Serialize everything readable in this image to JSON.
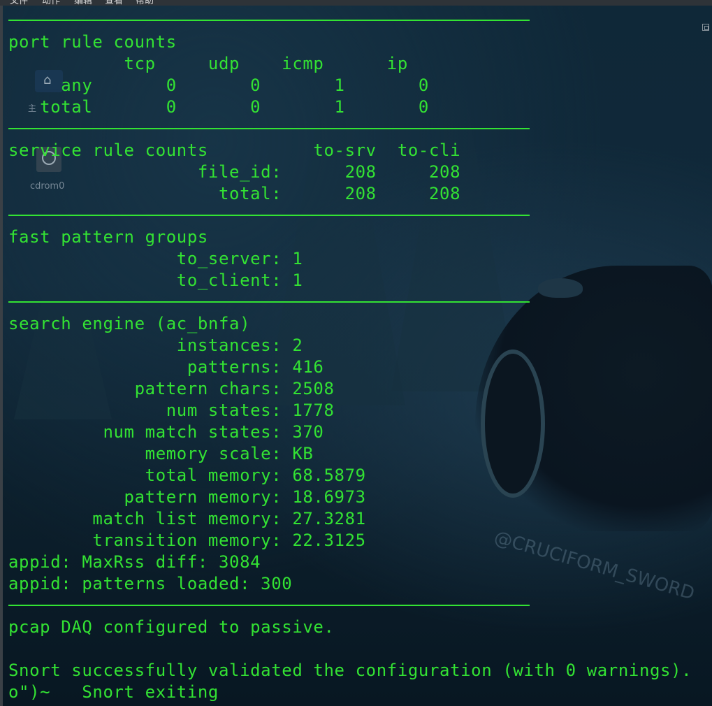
{
  "menubar": {
    "items": [
      "文件",
      "动作",
      "编辑",
      "查看",
      "帮助"
    ]
  },
  "desktop": {
    "home_label": "主",
    "cdrom_label": "cdrom0"
  },
  "watermark": "@CRUCIFORM_SWORD",
  "terminal": {
    "port_rule_counts": {
      "title": "port rule counts",
      "header": "           tcp     udp    icmp      ip",
      "rows": [
        "     any       0       0       1       0",
        "   total       0       0       1       0"
      ]
    },
    "service_rule_counts": {
      "title": "service rule counts          to-srv  to-cli",
      "rows": [
        "                  file_id:      208     208",
        "                    total:      208     208"
      ]
    },
    "fast_pattern_groups": {
      "title": "fast pattern groups",
      "rows": [
        "                to_server: 1",
        "                to_client: 1"
      ]
    },
    "search_engine": {
      "title": "search engine (ac_bnfa)",
      "rows": [
        "                instances: 2",
        "                 patterns: 416",
        "            pattern chars: 2508",
        "               num states: 1778",
        "         num match states: 370",
        "             memory scale: KB",
        "             total memory: 68.5879",
        "           pattern memory: 18.6973",
        "        match list memory: 27.3281",
        "        transition memory: 22.3125"
      ]
    },
    "appid": [
      "appid: MaxRss diff: 3084",
      "appid: patterns loaded: 300"
    ],
    "daq": "pcap DAQ configured to passive.",
    "validated": "Snort successfully validated the configuration (with 0 warnings).",
    "exiting": "o\")~   Snort exiting"
  },
  "colors": {
    "terminal_text": "#33e233",
    "background": "#0f2838"
  }
}
